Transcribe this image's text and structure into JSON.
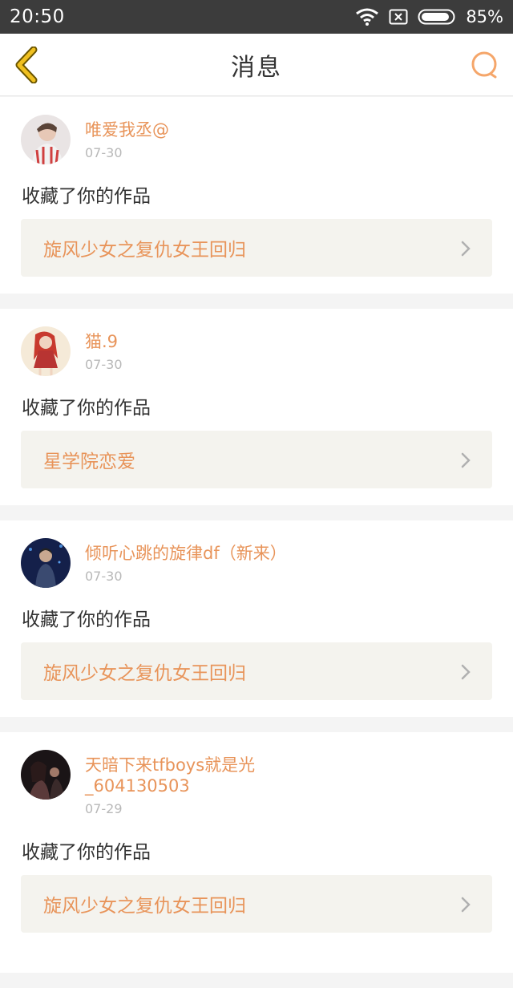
{
  "status_bar": {
    "time": "20:50",
    "battery": "85%"
  },
  "nav": {
    "title": "消息"
  },
  "messages": [
    {
      "user": "唯爱我丞@",
      "date": "07-30",
      "action": "收藏了你的作品",
      "work": "旋风少女之复仇女王回归"
    },
    {
      "user": "猫.9",
      "date": "07-30",
      "action": "收藏了你的作品",
      "work": "星学院恋爱"
    },
    {
      "user": "倾听心跳的旋律df（新来）",
      "date": "07-30",
      "action": "收藏了你的作品",
      "work": "旋风少女之复仇女王回归"
    },
    {
      "user_line1": "天暗下来tfboys就是光",
      "user_line2": "_604130503",
      "date": "07-29",
      "action": "收藏了你的作品",
      "work": "旋风少女之复仇女王回归"
    }
  ],
  "colors": {
    "accent": "#e8945a",
    "back_icon": "#f0c020",
    "search_icon": "#f5a66a"
  }
}
